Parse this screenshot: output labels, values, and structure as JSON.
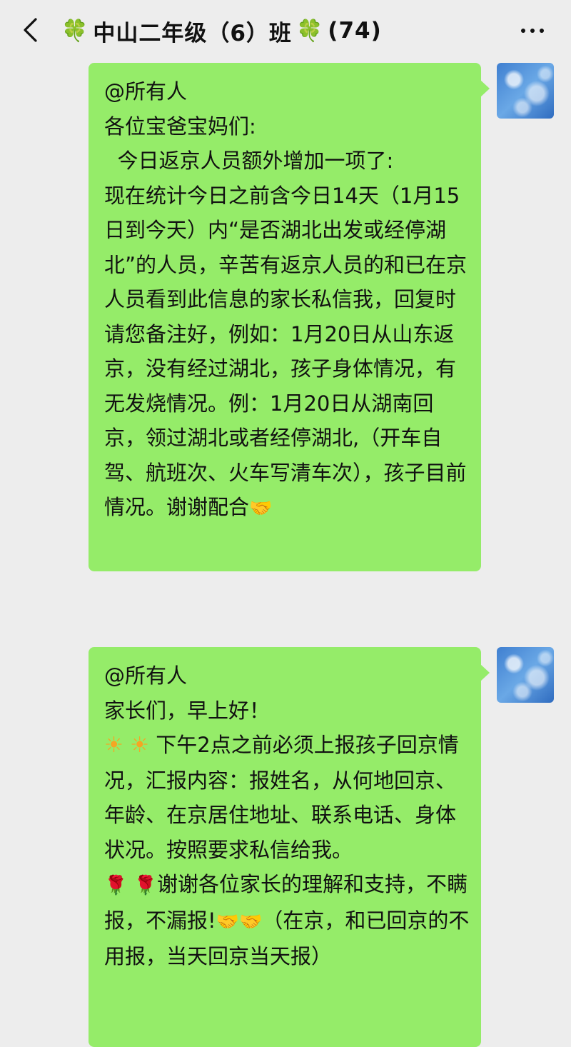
{
  "header": {
    "title": "中山二年级（6）班",
    "member_count": "(74)",
    "clover_icon": "🍀"
  },
  "messages": [
    {
      "mention": "@所有人",
      "lines": [
        "各位宝爸宝妈们:",
        "  今日返京人员额外增加一项了:",
        "现在统计今日之前含今日14天（1月15日到今天）内“是否湖北出发或经停湖北”的人员，辛苦有返京人员的和已在京人员看到此信息的家长私信我，回复时请您备注好，例如：1月20日从山东返京，没有经过湖北，孩子身体情况，有无发烧情况。例：1月20日从湖南回京，领过湖北或者经停湖北,（开车自驾、航班次、火车写清车次），孩子目前情况。谢谢配合"
      ],
      "end_icon": "handshake-icon"
    },
    {
      "mention": "@所有人",
      "greeting": "家长们，早上好！",
      "para1": "下午2点之前必须上报孩子回京情况，汇报内容：报姓名，从何地回京、年龄、在京居住地址、联系电话、身体状况。按照要求私信给我。",
      "para2a": "谢谢各位家长的理解和支持，不瞒报，不漏报!",
      "para2b": "（在京，和已回京的不用报，当天回京当天报）"
    }
  ]
}
